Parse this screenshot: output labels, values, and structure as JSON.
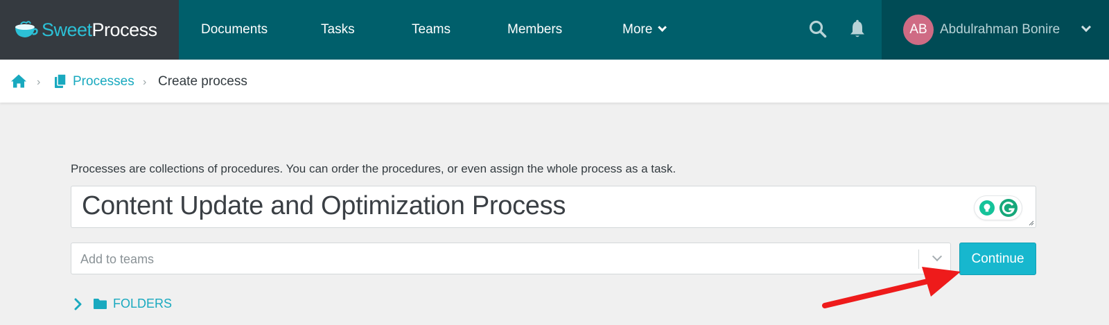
{
  "brand": {
    "sweet": "Sweet",
    "process": "Process"
  },
  "nav": {
    "documents": "Documents",
    "tasks": "Tasks",
    "teams": "Teams",
    "members": "Members",
    "more": "More"
  },
  "user": {
    "initials": "AB",
    "name": "Abdulrahman Bonire"
  },
  "breadcrumb": {
    "processes": "Processes",
    "current": "Create process"
  },
  "main": {
    "description": "Processes are collections of procedures. You can order the procedures, or even assign the whole process as a task.",
    "title_value": "Content Update and Optimization Process",
    "teams_placeholder": "Add to teams",
    "continue_label": "Continue",
    "folders_label": "FOLDERS"
  },
  "colors": {
    "nav_bg": "#005f6b",
    "brand_bg": "#353a40",
    "user_bg": "#004b55",
    "accent": "#17b7ce",
    "avatar": "#cf6b84",
    "annotation_arrow": "#ee1b1b"
  },
  "icons": [
    "sweetprocess-logo-icon",
    "search-icon",
    "bell-icon",
    "chevron-down-icon",
    "home-icon",
    "documents-icon",
    "grammarly-icon",
    "lightbulb-icon",
    "chevron-right-icon",
    "folder-icon"
  ]
}
